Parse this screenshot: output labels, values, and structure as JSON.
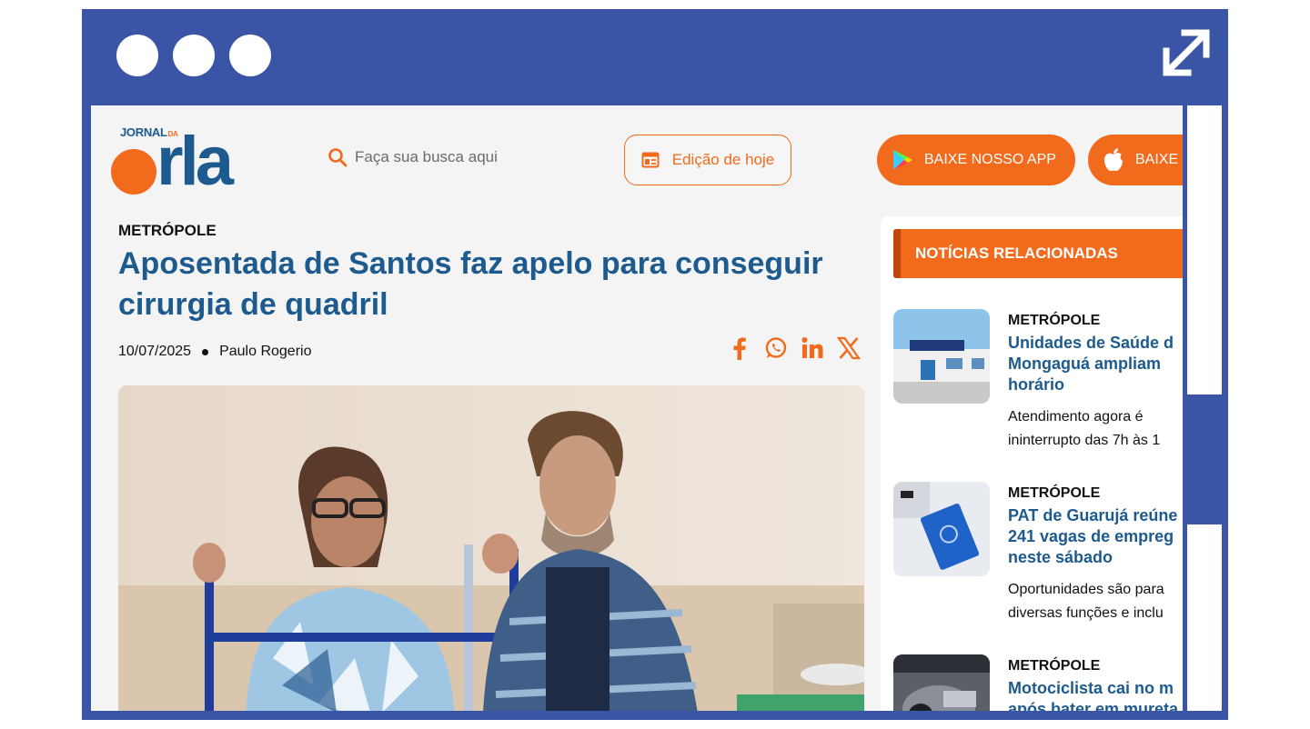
{
  "header": {
    "logo": {
      "top": "JORNAL",
      "da": "DA",
      "main": "rla"
    },
    "search_placeholder": "Faça sua busca aqui",
    "edition_label": "Edição de hoje",
    "app_android_label": "BAIXE NOSSO APP",
    "app_apple_label": "BAIXE"
  },
  "article": {
    "category": "METRÓPOLE",
    "headline": "Aposentada de Santos faz apelo para conseguir cirurgia de quadril",
    "date": "10/07/2025",
    "author": "Paulo Rogerio",
    "share": [
      "facebook-icon",
      "whatsapp-icon",
      "linkedin-icon",
      "x-icon"
    ]
  },
  "sidebar": {
    "title": "NOTÍCIAS RELACIONADAS",
    "items": [
      {
        "category": "METRÓPOLE",
        "title": "Unidades de Saúde d\nMongaguá ampliam\nhorário",
        "desc": "Atendimento agora é\nininterrupto das 7h às 1"
      },
      {
        "category": "METRÓPOLE",
        "title": "PAT de Guarujá reúne\n241 vagas de empreg\nneste sábado",
        "desc": "Oportunidades são para\ndiversas funções e inclu"
      },
      {
        "category": "METRÓPOLE",
        "title": "Motociclista cai no m\napós bater em mureta",
        "desc": ""
      }
    ]
  },
  "colors": {
    "frame": "#3a55a5",
    "accent": "#f26a1b",
    "brand_blue": "#1d5a8e"
  }
}
